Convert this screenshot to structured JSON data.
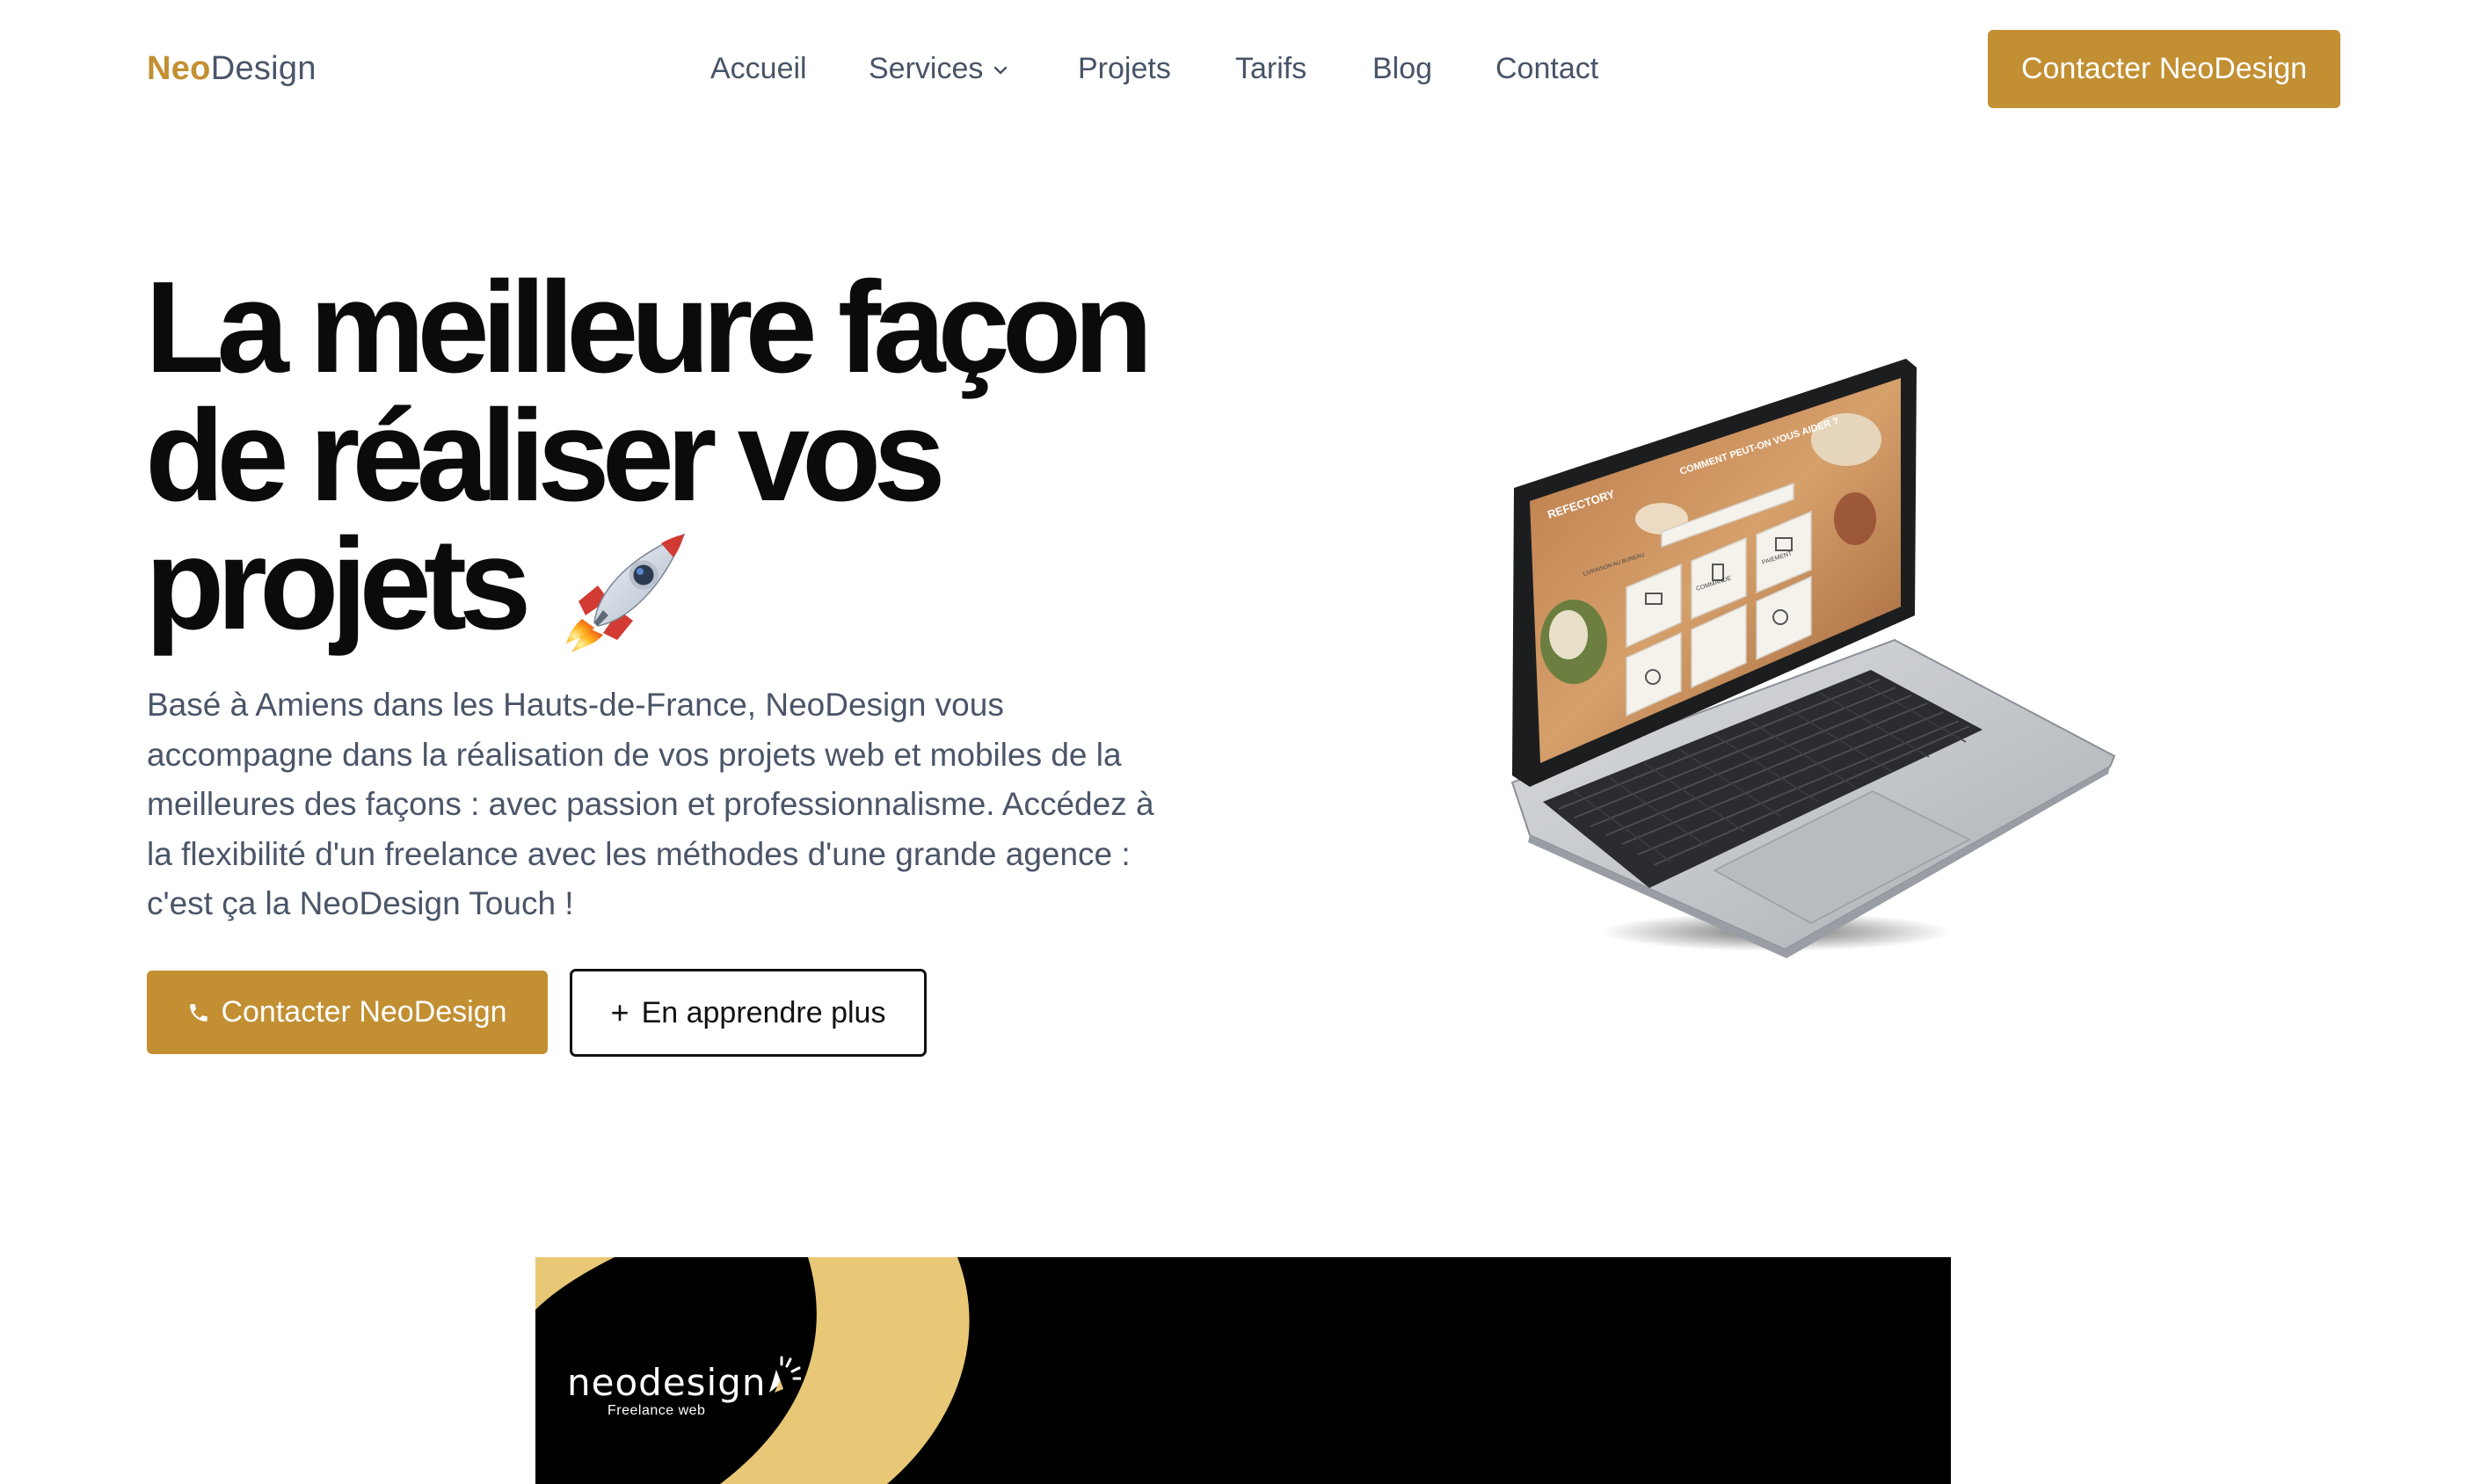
{
  "header": {
    "logo": {
      "part1": "Neo",
      "part2": "Design"
    },
    "nav": [
      {
        "label": "Accueil"
      },
      {
        "label": "Services",
        "has_dropdown": true
      },
      {
        "label": "Projets"
      },
      {
        "label": "Tarifs"
      },
      {
        "label": "Blog"
      },
      {
        "label": "Contact"
      }
    ],
    "cta_label": "Contacter NeoDesign"
  },
  "hero": {
    "title_lines": [
      "La meilleure façon",
      "de réaliser vos",
      "projets"
    ],
    "title_emoji": "rocket",
    "description": "Basé à Amiens dans les Hauts-de-France, NeoDesign vous accompagne dans la réalisation de vos projets web et mobiles de la meilleures des façons : avec passion et professionnalisme. Accédez à la flexibilité d'un freelance avec les méthodes d'une grande agence : c'est ça la NeoDesign Touch !",
    "primary_button": {
      "label": "Contacter NeoDesign",
      "icon": "phone-icon"
    },
    "secondary_button": {
      "label": "En apprendre plus",
      "icon": "plus-icon"
    }
  },
  "laptop_screen": {
    "brand": "REFECTORY",
    "headline": "COMMENT PEUT-ON VOUS AIDER ?",
    "tiles": [
      "LIVRAISON AU BUREAU",
      "COMMANDE",
      "PAIEMENT"
    ]
  },
  "banner": {
    "logo_text": "neodesign",
    "tagline": "Freelance web"
  },
  "colors": {
    "brand": "#c28f33",
    "text_muted": "#4a5568",
    "banner_bg": "#000000",
    "banner_gold": "#e8c777"
  }
}
